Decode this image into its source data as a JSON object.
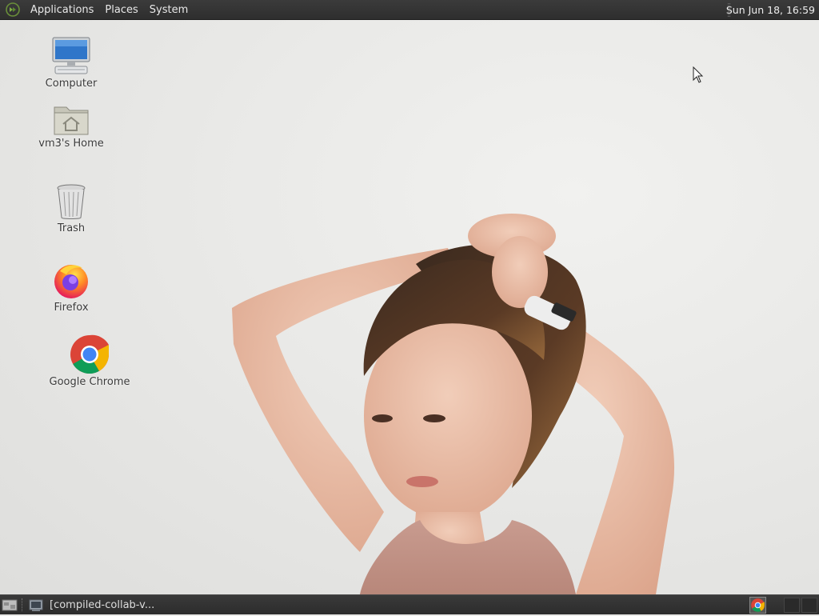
{
  "top_panel": {
    "menus": [
      {
        "label": "Applications"
      },
      {
        "label": "Places"
      },
      {
        "label": "System"
      }
    ],
    "clock": "Sun Jun 18, 16:59"
  },
  "desktop_icons": [
    {
      "label": "Computer",
      "icon": "computer-icon"
    },
    {
      "label": "vm3's Home",
      "icon": "home-folder-icon"
    },
    {
      "label": "Trash",
      "icon": "trash-icon"
    },
    {
      "label": "Firefox",
      "icon": "firefox-icon"
    },
    {
      "label": "Google Chrome",
      "icon": "chrome-icon"
    }
  ],
  "bottom_panel": {
    "task_label": "[compiled-collab-v...",
    "task_icon": "terminal-icon",
    "tray_icon": "chrome-icon",
    "workspaces": 2
  },
  "colors": {
    "panel": "#2e2e2e",
    "desktop_bg": "#e8e8e6",
    "chrome_red": "#db4437",
    "chrome_yellow": "#f4b400",
    "chrome_green": "#0f9d58",
    "chrome_blue": "#4285f4"
  }
}
